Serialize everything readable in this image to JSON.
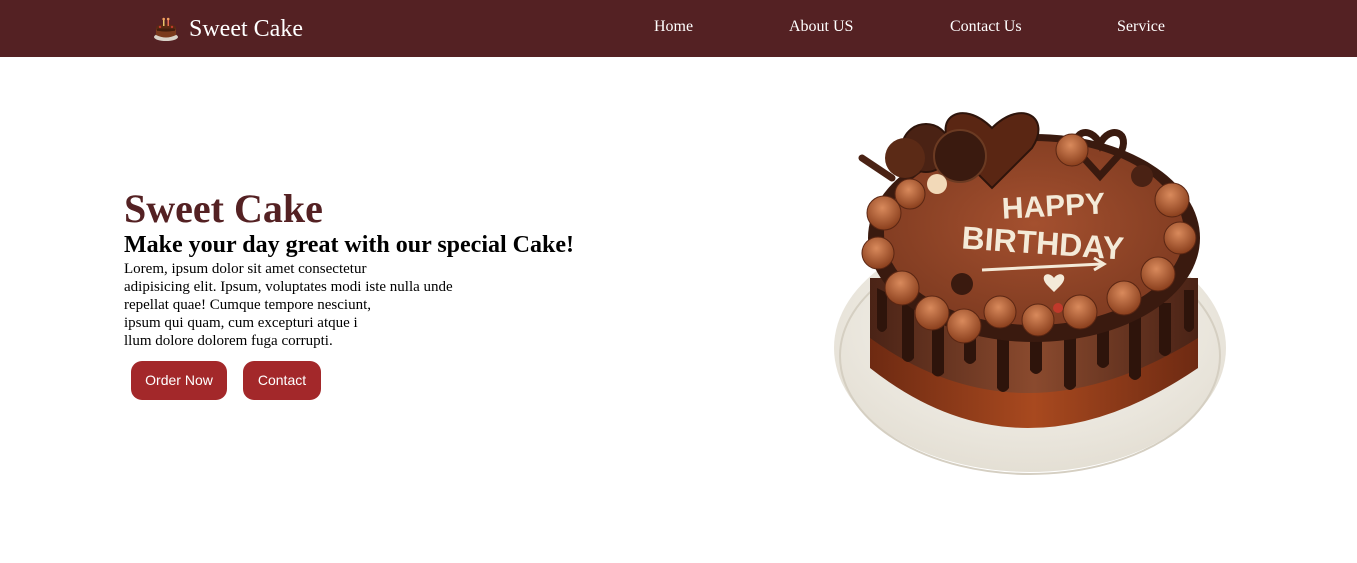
{
  "header": {
    "brand": "Sweet Cake",
    "brand_icon": "cake-icon",
    "nav": {
      "home": "Home",
      "about": "About US",
      "contact": "Contact Us",
      "service": "Service"
    }
  },
  "hero": {
    "title": "Sweet Cake",
    "subtitle": "Make your day great with our special Cake!",
    "description": [
      "Lorem, ipsum dolor sit amet consectetur",
      "adipisicing elit. Ipsum, voluptates modi iste nulla unde",
      "repellat quae! Cumque tempore nesciunt,",
      "ipsum qui quam, cum excepturi atque i",
      "llum dolore dolorem fuga corrupti."
    ],
    "buttons": {
      "order": "Order Now",
      "contact": "Contact"
    }
  },
  "cake_image": {
    "icon": "birthday-cake-image",
    "lettering": [
      "HAPPY",
      "BIRTHDAY"
    ]
  },
  "colors": {
    "navbar": "#542123",
    "title": "#542123",
    "button": "#a3282a",
    "nav_text": "#ffffff"
  }
}
